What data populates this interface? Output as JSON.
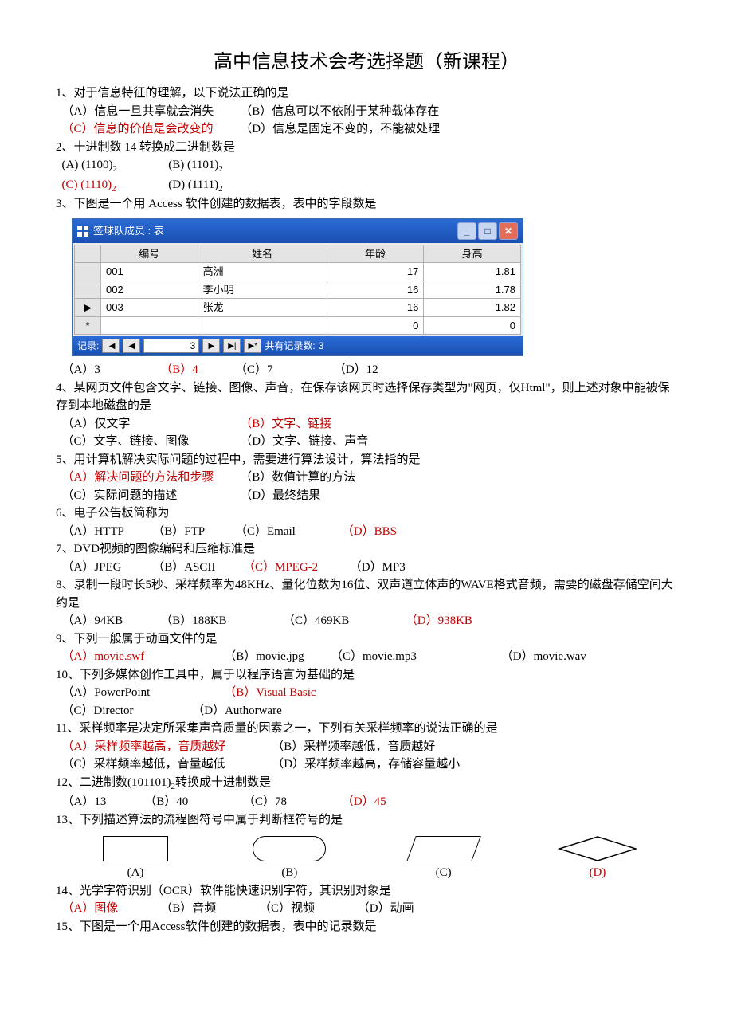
{
  "title": "高中信息技术会考选择题（新课程）",
  "q1": {
    "stem": "1、对于信息特征的理解，以下说法正确的是",
    "a": "（A）信息一旦共享就会消失",
    "b": "（B）信息可以不依附于某种载体存在",
    "c": "（C）信息的价值是会改变的",
    "d": "（D）信息是固定不变的，不能被处理"
  },
  "q2": {
    "stem": "2、十进制数 14 转换成二进制数是",
    "a": "(A) (1100)",
    "b": "(B) (1101)",
    "c": "(C) (1110)",
    "d": "(D) (1111)",
    "sub": "2"
  },
  "q3": {
    "stem": "3、下图是一个用 Access 软件创建的数据表，表中的字段数是",
    "a": "（A）3",
    "b": "（B）4",
    "c": "（C）7",
    "d": "（D）12"
  },
  "access": {
    "title": "签球队成员  :  表",
    "headers": [
      "编号",
      "姓名",
      "年龄",
      "身高"
    ],
    "rows": [
      {
        "sel": "",
        "id": "001",
        "name": "高洲",
        "age": "17",
        "height": "1.81"
      },
      {
        "sel": "",
        "id": "002",
        "name": "李小明",
        "age": "16",
        "height": "1.78"
      },
      {
        "sel": "▶",
        "id": "003",
        "name": "张龙",
        "age": "16",
        "height": "1.82"
      },
      {
        "sel": "*",
        "id": "",
        "name": "",
        "age": "0",
        "height": "0"
      }
    ],
    "nav": {
      "label": "记录:",
      "current": "3",
      "total_label": "共有记录数:",
      "total": "3"
    }
  },
  "q4": {
    "stem": "4、某网页文件包含文字、链接、图像、声音，在保存该网页时选择保存类型为\"网页，仅Html\"，则上述对象中能被保存到本地磁盘的是",
    "a": "（A）仅文字",
    "b": "（B）文字、链接",
    "c": "（C）文字、链接、图像",
    "d": "（D）文字、链接、声音"
  },
  "q5": {
    "stem": "5、用计算机解决实际问题的过程中，需要进行算法设计，算法指的是",
    "a": "（A）解决问题的方法和步骤",
    "b": "（B）数值计算的方法",
    "c": "（C）实际问题的描述",
    "d": "（D）最终结果"
  },
  "q6": {
    "stem": "6、电子公告板简称为",
    "a": "（A）HTTP",
    "b": "（B）FTP",
    "c": "（C）Email",
    "d": "（D）BBS"
  },
  "q7": {
    "stem": "7、DVD视频的图像编码和压缩标准是",
    "a": "（A）JPEG",
    "b": "（B）ASCII",
    "c": "（C）MPEG-2",
    "d": "（D）MP3"
  },
  "q8": {
    "stem": "8、录制一段时长5秒、采样频率为48KHz、量化位数为16位、双声道立体声的WAVE格式音频，需要的磁盘存储空间大约是",
    "a": "（A）94KB",
    "b": "（B）188KB",
    "c": "（C）469KB",
    "d": "（D）938KB"
  },
  "q9": {
    "stem": "9、下列一般属于动画文件的是",
    "a": "（A）movie.swf",
    "b": "（B）movie.jpg",
    "c": "（C）movie.mp3",
    "d": "（D）movie.wav"
  },
  "q10": {
    "stem": "10、下列多媒体创作工具中，属于以程序语言为基础的是",
    "a": "（A）PowerPoint",
    "b": "（B）Visual Basic",
    "c": "（C）Director",
    "d": "（D）Authorware"
  },
  "q11": {
    "stem": "11、采样频率是决定所采集声音质量的因素之一，下列有关采样频率的说法正确的是",
    "a": "（A）采样频率越高，音质越好",
    "b": "（B）采样频率越低，音质越好",
    "c": "（C）采样频率越低，音量越低",
    "d": "（D）采样频率越高，存储容量越小"
  },
  "q12": {
    "stem_a": "12、二进制数(101101)",
    "stem_b": "转换成十进制数是",
    "sub": "2",
    "a": "（A）13",
    "b": "（B）40",
    "c": "（C）78",
    "d": "（D）45"
  },
  "q13": {
    "stem": "13、下列描述算法的流程图符号中属于判断框符号的是",
    "a": "(A)",
    "b": "(B)",
    "c": "(C)",
    "d": "(D)"
  },
  "q14": {
    "stem": "14、光学字符识别（OCR）软件能快速识别字符，其识别对象是",
    "a": "（A）图像",
    "b": "（B）音频",
    "c": "（C）视频",
    "d": "（D）动画"
  },
  "q15": {
    "stem": "15、下图是一个用Access软件创建的数据表，表中的记录数是"
  }
}
